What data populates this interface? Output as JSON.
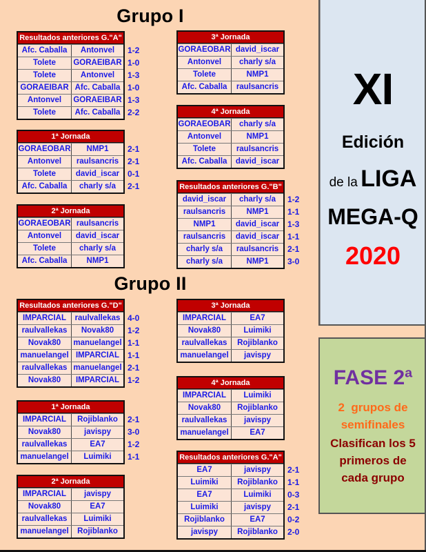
{
  "grupo1": {
    "title": "Grupo I",
    "tables": [
      {
        "title": "Resultados anteriores G.\"A\"",
        "matches": [
          {
            "home": "Afc. Caballa",
            "away": "Antonvel",
            "score": "1-2"
          },
          {
            "home": "Tolete",
            "away": "GORAEIBAR",
            "score": "1-0"
          },
          {
            "home": "Tolete",
            "away": "Antonvel",
            "score": "1-3"
          },
          {
            "home": "GORAEIBAR",
            "away": "Afc. Caballa",
            "score": "1-0"
          },
          {
            "home": "Antonvel",
            "away": "GORAEIBAR",
            "score": "1-3"
          },
          {
            "home": "Tolete",
            "away": "Afc. Caballa",
            "score": "2-2"
          }
        ]
      },
      {
        "title": "1ª Jornada",
        "matches": [
          {
            "home": "GORAEOBAR",
            "away": "NMP1",
            "score": "2-1"
          },
          {
            "home": "Antonvel",
            "away": "raulsancris",
            "score": "2-1"
          },
          {
            "home": "Tolete",
            "away": "david_iscar",
            "score": "0-1"
          },
          {
            "home": "Afc. Caballa",
            "away": "charly s/a",
            "score": "2-1"
          }
        ]
      },
      {
        "title": "2ª Jornada",
        "matches": [
          {
            "home": "GORAEOBAR",
            "away": "raulsancris",
            "score": ""
          },
          {
            "home": "Antonvel",
            "away": "david_iscar",
            "score": ""
          },
          {
            "home": "Tolete",
            "away": "charly s/a",
            "score": ""
          },
          {
            "home": "Afc. Caballa",
            "away": "NMP1",
            "score": ""
          }
        ]
      },
      {
        "title": "3ª Jornada",
        "matches": [
          {
            "home": "GORAEOBAR",
            "away": "david_iscar",
            "score": ""
          },
          {
            "home": "Antonvel",
            "away": "charly s/a",
            "score": ""
          },
          {
            "home": "Tolete",
            "away": "NMP1",
            "score": ""
          },
          {
            "home": "Afc. Caballa",
            "away": "raulsancris",
            "score": ""
          }
        ]
      },
      {
        "title": "4ª Jornada",
        "matches": [
          {
            "home": "GORAEOBAR",
            "away": "charly s/a",
            "score": ""
          },
          {
            "home": "Antonvel",
            "away": "NMP1",
            "score": ""
          },
          {
            "home": "Tolete",
            "away": "raulsancris",
            "score": ""
          },
          {
            "home": "Afc. Caballa",
            "away": "david_iscar",
            "score": ""
          }
        ]
      },
      {
        "title": "Resultados anteriores G.\"B\"",
        "matches": [
          {
            "home": "david_iscar",
            "away": "charly s/a",
            "score": "1-2"
          },
          {
            "home": "raulsancris",
            "away": "NMP1",
            "score": "1-1"
          },
          {
            "home": "NMP1",
            "away": "david_iscar",
            "score": "1-3"
          },
          {
            "home": "raulsancris",
            "away": "david_iscar",
            "score": "1-1"
          },
          {
            "home": "charly s/a",
            "away": "raulsancris",
            "score": "2-1"
          },
          {
            "home": "charly s/a",
            "away": "NMP1",
            "score": "3-0"
          }
        ]
      }
    ]
  },
  "grupo2": {
    "title": "Grupo II",
    "tables": [
      {
        "title": "Resultados anteriores G.\"D\"",
        "matches": [
          {
            "home": "IMPARCIAL",
            "away": "raulvallekas",
            "score": "4-0"
          },
          {
            "home": "raulvallekas",
            "away": "Novak80",
            "score": "1-2"
          },
          {
            "home": "Novak80",
            "away": "manuelangel",
            "score": "1-1"
          },
          {
            "home": "manuelangel",
            "away": "IMPARCIAL",
            "score": "1-1"
          },
          {
            "home": "raulvallekas",
            "away": "manuelangel",
            "score": "2-1"
          },
          {
            "home": "Novak80",
            "away": "IMPARCIAL",
            "score": "1-2"
          }
        ]
      },
      {
        "title": "1ª Jornada",
        "matches": [
          {
            "home": "IMPARCIAL",
            "away": "Rojiblanko",
            "score": "2-1"
          },
          {
            "home": "Novak80",
            "away": "javispy",
            "score": "3-0"
          },
          {
            "home": "raulvallekas",
            "away": "EA7",
            "score": "1-2"
          },
          {
            "home": "manuelangel",
            "away": "Luimiki",
            "score": "1-1"
          }
        ]
      },
      {
        "title": "2ª Jornada",
        "matches": [
          {
            "home": "IMPARCIAL",
            "away": "javispy",
            "score": ""
          },
          {
            "home": "Novak80",
            "away": "EA7",
            "score": ""
          },
          {
            "home": "raulvallekas",
            "away": "Luimiki",
            "score": ""
          },
          {
            "home": "manuelangel",
            "away": "Rojiblanko",
            "score": ""
          }
        ]
      },
      {
        "title": "3ª Jornada",
        "matches": [
          {
            "home": "IMPARCIAL",
            "away": "EA7",
            "score": ""
          },
          {
            "home": "Novak80",
            "away": "Luimiki",
            "score": ""
          },
          {
            "home": "raulvallekas",
            "away": "Rojiblanko",
            "score": ""
          },
          {
            "home": "manuelangel",
            "away": "javispy",
            "score": ""
          }
        ]
      },
      {
        "title": "4ª Jornada",
        "matches": [
          {
            "home": "IMPARCIAL",
            "away": "Luimiki",
            "score": ""
          },
          {
            "home": "Novak80",
            "away": "Rojiblanko",
            "score": ""
          },
          {
            "home": "raulvallekas",
            "away": "javispy",
            "score": ""
          },
          {
            "home": "manuelangel",
            "away": "EA7",
            "score": ""
          }
        ]
      },
      {
        "title": "Resultados anteriores G.\"A\"",
        "matches": [
          {
            "home": "EA7",
            "away": "javispy",
            "score": "2-1"
          },
          {
            "home": "Luimiki",
            "away": "Rojiblanko",
            "score": "1-1"
          },
          {
            "home": "EA7",
            "away": "Luimiki",
            "score": "0-3"
          },
          {
            "home": "Luimiki",
            "away": "javispy",
            "score": "2-1"
          },
          {
            "home": "Rojiblanko",
            "away": "EA7",
            "score": "0-2"
          },
          {
            "home": "javispy",
            "away": "Rojiblanko",
            "score": "2-0"
          }
        ]
      }
    ]
  },
  "banner": {
    "edition_number": "XI",
    "edition_label": "Edición",
    "de_la": "de la",
    "liga": "LIGA",
    "name": "MEGA-Q",
    "year": "2020"
  },
  "phase": {
    "title": "FASE 2ª",
    "subtitle_line1": "2  grupos de",
    "subtitle_line2": "semifinales",
    "note_line1": "Clasifican los 5",
    "note_line2": "primeros de",
    "note_line3": "cada grupo"
  },
  "colors": {
    "background": "#fcd5b4",
    "header_red": "#c00000",
    "team_blue": "#1a1ae6",
    "banner_blue": "#dce6f1",
    "phase_green": "#c4d79b",
    "year_red": "#ff0000",
    "phase_purple": "#7030a0",
    "phase_orange": "#ff6a1a",
    "phase_darkred": "#8b0000"
  }
}
